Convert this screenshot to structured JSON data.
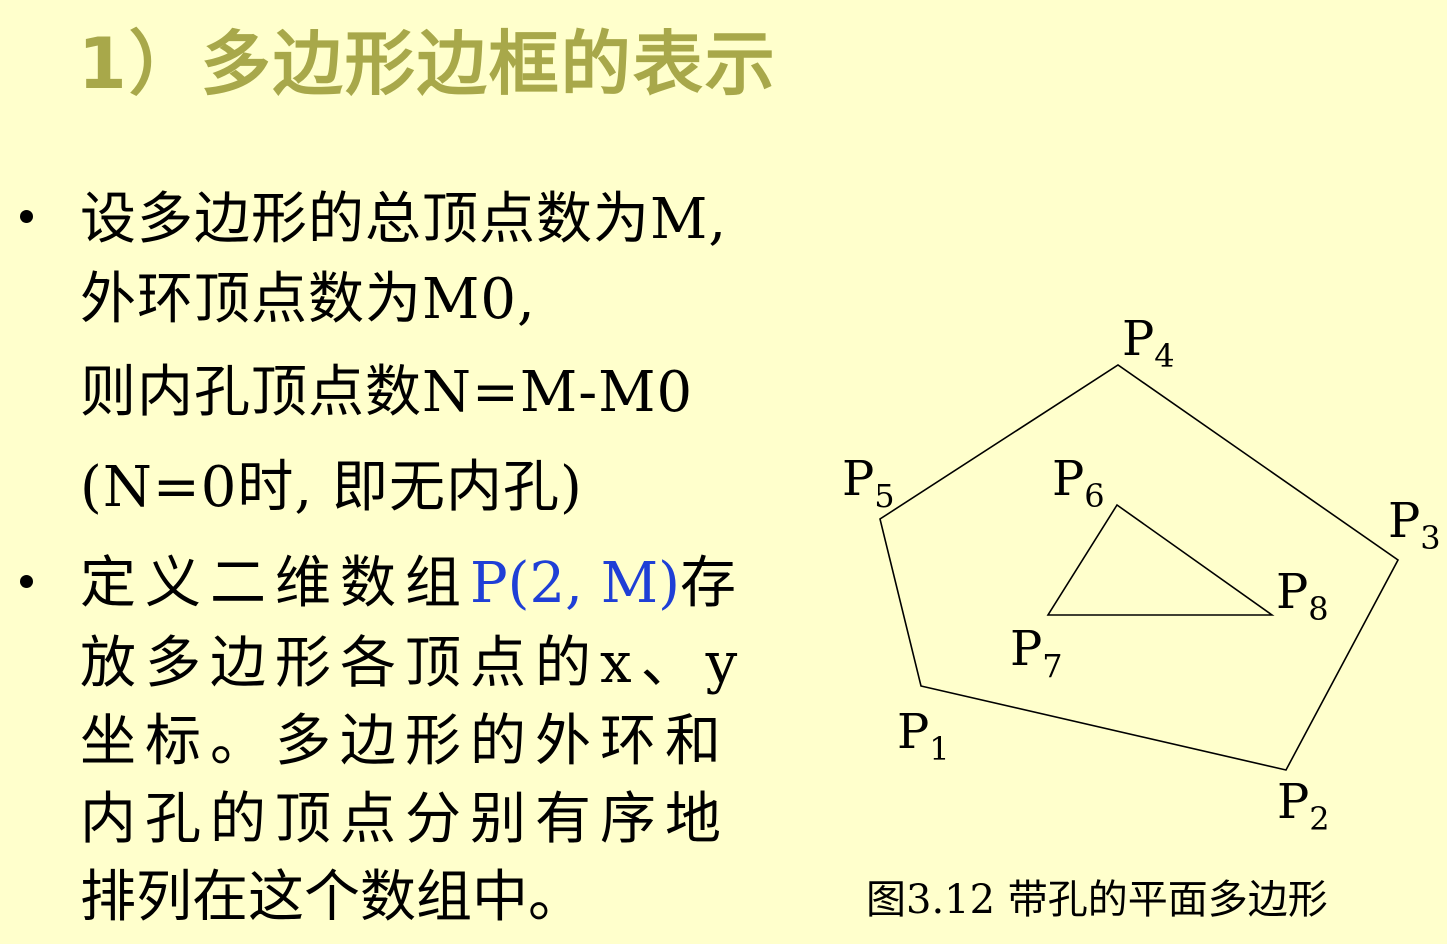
{
  "title": "1）多边形边框的表示",
  "bullets": [
    {
      "lines": [
        "设多边形的总顶点数为M,",
        "外环顶点数为M0,",
        "则内孔顶点数N=M-M0",
        "(N=0时, 即无内孔)"
      ]
    },
    {
      "line1_prefix": "定义二维数组",
      "line1_highlight": "P(2,  M)",
      "line1_suffix": "存",
      "lines": [
        "放多边形各顶点的x、y",
        "坐标。多边形的外环和",
        "内孔的顶点分别有序地",
        "排列在这个数组中。"
      ]
    }
  ],
  "figure": {
    "caption": "图3.12 带孔的平面多边形",
    "labels": [
      {
        "base": "P",
        "sub": "1"
      },
      {
        "base": "P",
        "sub": "2"
      },
      {
        "base": "P",
        "sub": "3"
      },
      {
        "base": "P",
        "sub": "4"
      },
      {
        "base": "P",
        "sub": "5"
      },
      {
        "base": "P",
        "sub": "6"
      },
      {
        "base": "P",
        "sub": "7"
      },
      {
        "base": "P",
        "sub": "8"
      }
    ]
  }
}
